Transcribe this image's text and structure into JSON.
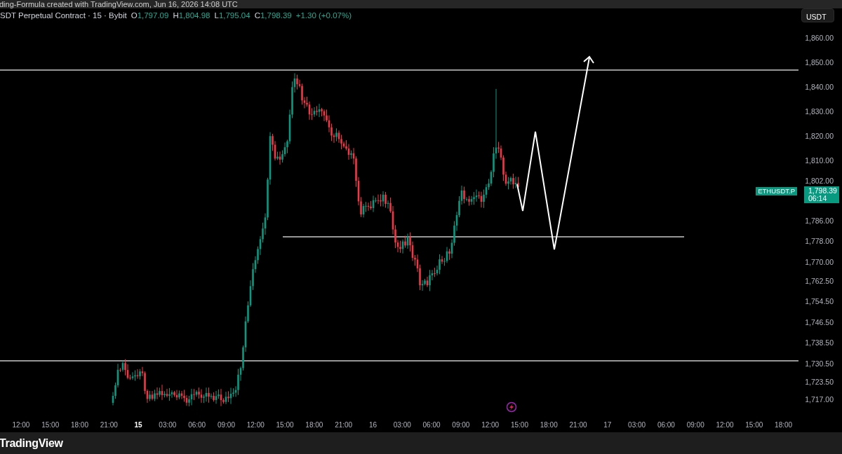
{
  "caption": "ding-Formula created with TradingView.com, Jun 16, 2026 14:08 UTC",
  "legend": {
    "title": "SDT Perpetual Contract · 15 · Bybit",
    "ohlc": [
      {
        "label": "O",
        "value": "1,797.09"
      },
      {
        "label": "H",
        "value": "1,804.98"
      },
      {
        "label": "L",
        "value": "1,795.04"
      },
      {
        "label": "C",
        "value": "1,798.39"
      }
    ],
    "change": "+1.30 (+0.07%)"
  },
  "currency_button": "USDT",
  "price_axis": [
    "1,860.00",
    "1,850.00",
    "1,840.00",
    "1,830.00",
    "1,820.00",
    "1,810.00",
    "1,802.00",
    "1,786.00",
    "1,778.00",
    "1,770.00",
    "1,762.50",
    "1,754.50",
    "1,746.50",
    "1,738.50",
    "1,730.50",
    "1,723.50",
    "1,717.00"
  ],
  "last_price": {
    "symbol": "ETHUSDT.P",
    "price": "1,798.39",
    "countdown": "06:14"
  },
  "time_axis": [
    {
      "label": "12:00",
      "kind": "time"
    },
    {
      "label": "15:00",
      "kind": "time"
    },
    {
      "label": "18:00",
      "kind": "time"
    },
    {
      "label": "21:00",
      "kind": "time"
    },
    {
      "label": "15",
      "kind": "day"
    },
    {
      "label": "03:00",
      "kind": "time"
    },
    {
      "label": "06:00",
      "kind": "time"
    },
    {
      "label": "09:00",
      "kind": "time"
    },
    {
      "label": "12:00",
      "kind": "time"
    },
    {
      "label": "15:00",
      "kind": "time"
    },
    {
      "label": "18:00",
      "kind": "time"
    },
    {
      "label": "21:00",
      "kind": "time"
    },
    {
      "label": "16",
      "kind": "time"
    },
    {
      "label": "03:00",
      "kind": "time"
    },
    {
      "label": "06:00",
      "kind": "time"
    },
    {
      "label": "09:00",
      "kind": "time"
    },
    {
      "label": "12:00",
      "kind": "time"
    },
    {
      "label": "15:00",
      "kind": "time"
    },
    {
      "label": "18:00",
      "kind": "time"
    },
    {
      "label": "21:00",
      "kind": "time"
    },
    {
      "label": "17",
      "kind": "time"
    },
    {
      "label": "03:00",
      "kind": "time"
    },
    {
      "label": "06:00",
      "kind": "time"
    },
    {
      "label": "09:00",
      "kind": "time"
    },
    {
      "label": "12:00",
      "kind": "time"
    },
    {
      "label": "15:00",
      "kind": "time"
    },
    {
      "label": "18:00",
      "kind": "time"
    }
  ],
  "footer": {
    "logo_text": "TradingView"
  }
}
